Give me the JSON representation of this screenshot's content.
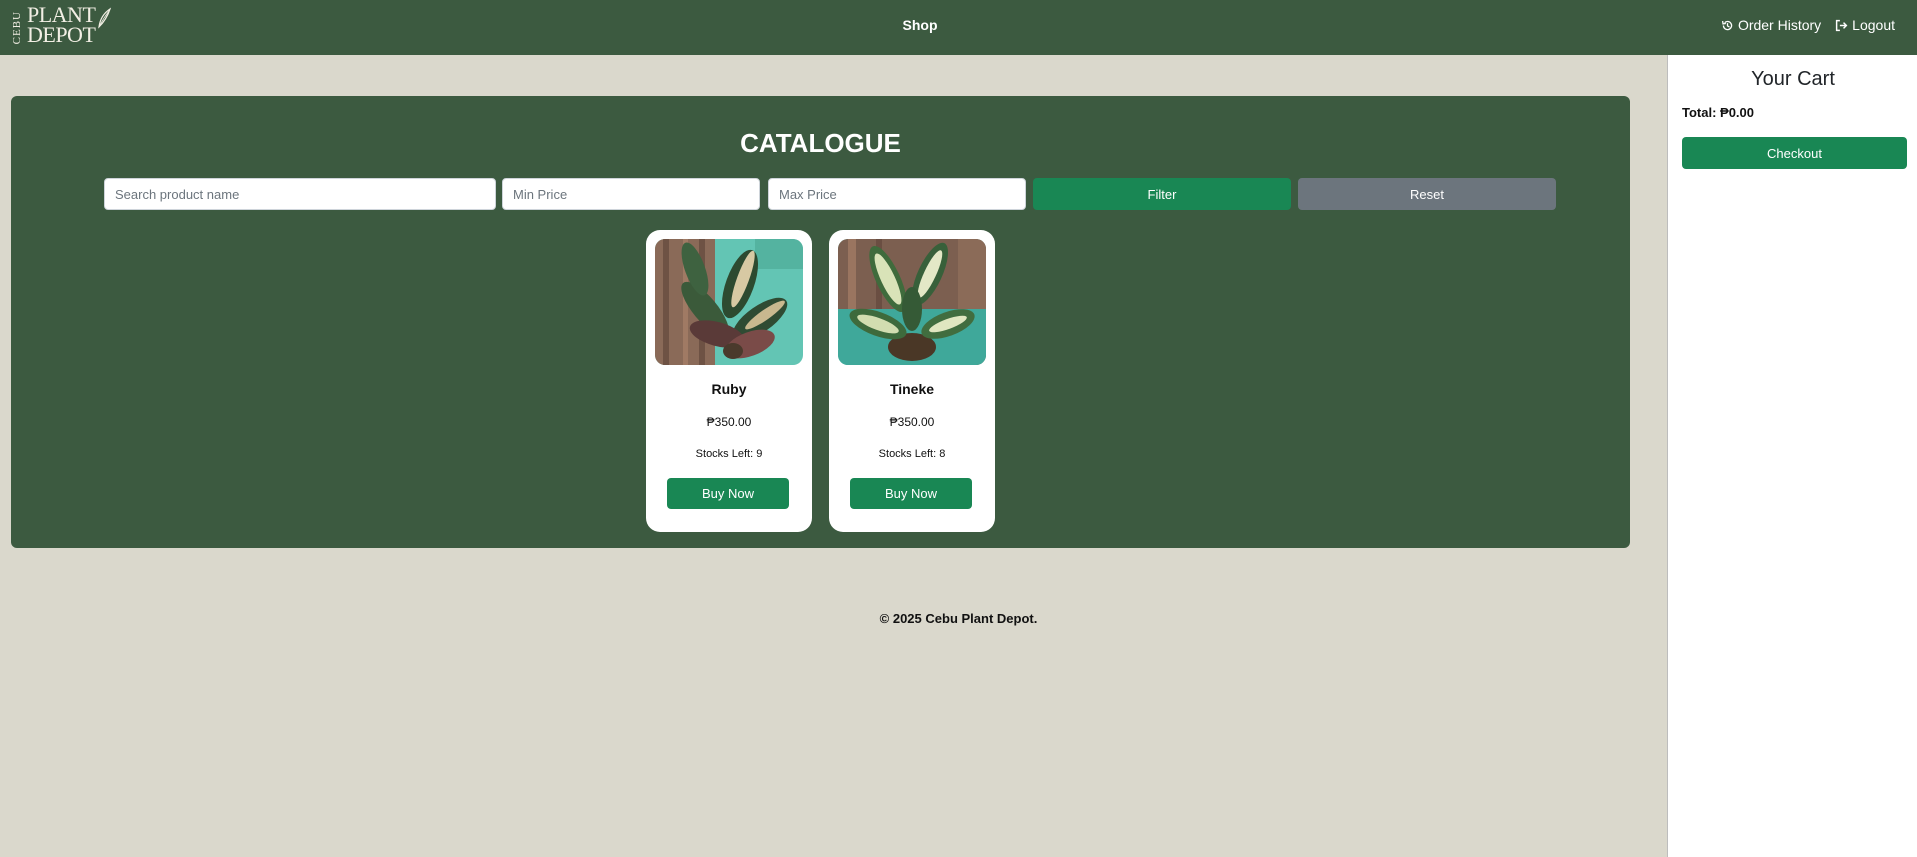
{
  "brand": {
    "line1": "PLANT",
    "line2": "DEPOT",
    "vertical": "CEBU"
  },
  "nav": {
    "shop": "Shop",
    "order_history": "Order History",
    "logout": "Logout"
  },
  "catalogue": {
    "title": "CATALOGUE",
    "search_placeholder": "Search product name",
    "min_price_placeholder": "Min Price",
    "max_price_placeholder": "Max Price",
    "filter_label": "Filter",
    "reset_label": "Reset",
    "products": [
      {
        "name": "Ruby",
        "price": "₱350.00",
        "stock": "Stocks Left: 9",
        "button": "Buy Now"
      },
      {
        "name": "Tineke",
        "price": "₱350.00",
        "stock": "Stocks Left: 8",
        "button": "Buy Now"
      }
    ]
  },
  "cart": {
    "title": "Your Cart",
    "total": "Total: ₱0.00",
    "checkout_label": "Checkout"
  },
  "footer": {
    "text": "© 2025 Cebu Plant Depot."
  },
  "colors": {
    "nav": "#3c5a40",
    "accent": "#198754",
    "secondary": "#6c757d",
    "background": "#dad8cc"
  }
}
